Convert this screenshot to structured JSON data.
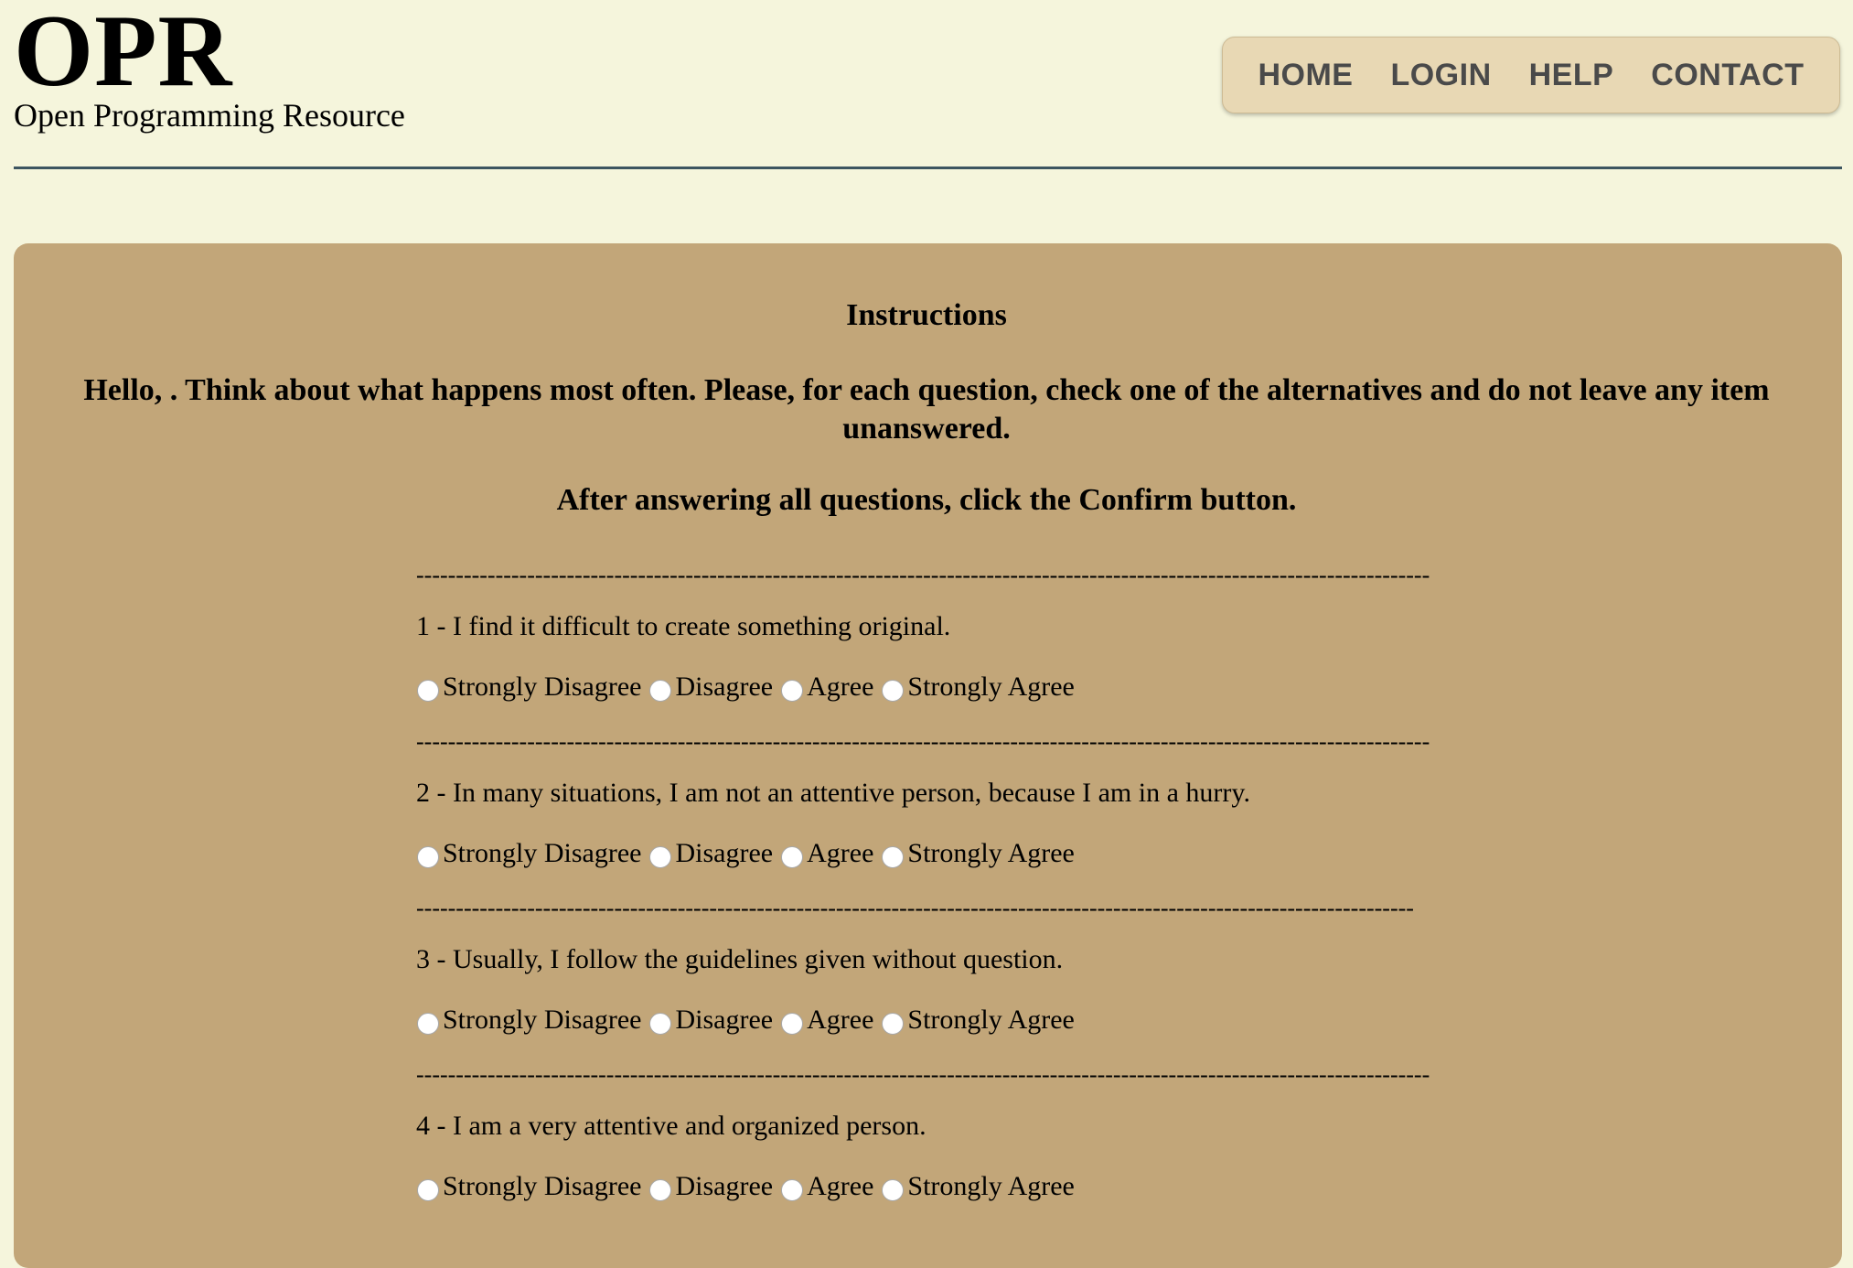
{
  "header": {
    "logo_title": "OPR",
    "logo_subtitle": "Open Programming Resource"
  },
  "nav": {
    "items": [
      "HOME",
      "LOGIN",
      "HELP",
      "CONTACT"
    ]
  },
  "instructions": {
    "title": "Instructions",
    "text": "Hello, . Think about what happens most often. Please, for each question, check one of the alternatives and do not leave any item unanswered.",
    "confirm_note": "After answering all questions, click the Confirm button."
  },
  "questions": [
    {
      "separator": "--------------------------------------------------------------------------------------------------------------------------------",
      "text": "1 - I find it difficult to create something original.",
      "options": [
        "Strongly Disagree",
        "Disagree",
        "Agree",
        "Strongly Agree"
      ]
    },
    {
      "separator": "--------------------------------------------------------------------------------------------------------------------------------",
      "text": "2 - In many situations, I am not an attentive person, because I am in a hurry.",
      "options": [
        "Strongly Disagree",
        "Disagree",
        "Agree",
        "Strongly Agree"
      ]
    },
    {
      "separator": "------------------------------------------------------------------------------------------------------------------------------",
      "text": "3 - Usually, I follow the guidelines given without question.",
      "options": [
        "Strongly Disagree",
        "Disagree",
        "Agree",
        "Strongly Agree"
      ]
    },
    {
      "separator": "--------------------------------------------------------------------------------------------------------------------------------",
      "text": "4 - I am a very attentive and organized person.",
      "options": [
        "Strongly Disagree",
        "Disagree",
        "Agree",
        "Strongly Agree"
      ]
    }
  ],
  "colors": {
    "page_background": "#f5f5dc",
    "panel_background": "#c2a679",
    "nav_background": "#e8d8b4",
    "nav_text": "#4a4a4a",
    "header_rule": "#3d5560"
  }
}
